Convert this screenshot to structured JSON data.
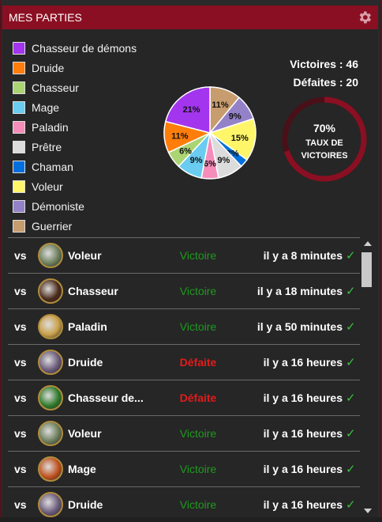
{
  "header": {
    "title": "MES PARTIES"
  },
  "legend": [
    {
      "label": "Chasseur de démons",
      "color": "#a335ee"
    },
    {
      "label": "Druide",
      "color": "#ff7d0a"
    },
    {
      "label": "Chasseur",
      "color": "#abd473"
    },
    {
      "label": "Mage",
      "color": "#69ccf0"
    },
    {
      "label": "Paladin",
      "color": "#f58cba"
    },
    {
      "label": "Prêtre",
      "color": "#dcdcdc"
    },
    {
      "label": "Chaman",
      "color": "#0070de"
    },
    {
      "label": "Voleur",
      "color": "#fff569"
    },
    {
      "label": "Démoniste",
      "color": "#9482c9"
    },
    {
      "label": "Guerrier",
      "color": "#c79c6e"
    }
  ],
  "stats": {
    "victoires": "Victoires : 46",
    "defaites": "Défaites : 20"
  },
  "winrate": {
    "percent": "70%",
    "label_line1": "TAUX DE",
    "label_line2": "VICTOIRES",
    "value": 0.7
  },
  "chart_data": {
    "type": "pie",
    "slices": [
      {
        "class": "Guerrier",
        "value": 11,
        "label": "11%",
        "color": "#c79c6e"
      },
      {
        "class": "Démoniste",
        "value": 9,
        "label": "9%",
        "color": "#9482c9"
      },
      {
        "class": "Voleur",
        "value": 15,
        "label": "15%",
        "color": "#fff569"
      },
      {
        "class": "Chaman",
        "value": 3,
        "label": "3%",
        "color": "#0070de"
      },
      {
        "class": "Prêtre",
        "value": 9,
        "label": "9%",
        "color": "#dcdcdc"
      },
      {
        "class": "Paladin",
        "value": 6,
        "label": "6%",
        "color": "#f58cba"
      },
      {
        "class": "Mage",
        "value": 9,
        "label": "9%",
        "color": "#69ccf0"
      },
      {
        "class": "Chasseur",
        "value": 6,
        "label": "6%",
        "color": "#abd473"
      },
      {
        "class": "Druide",
        "value": 11,
        "label": "11%",
        "color": "#ff7d0a"
      },
      {
        "class": "Chasseur de démons",
        "value": 21,
        "label": "21%",
        "color": "#a335ee"
      }
    ]
  },
  "matches": [
    {
      "vs": "vs",
      "opponent": "Voleur",
      "result": "Victoire",
      "win": true,
      "time": "il y a 8 minutes",
      "check": "✓",
      "avatar_color": "#6b7d5a"
    },
    {
      "vs": "vs",
      "opponent": "Chasseur",
      "result": "Victoire",
      "win": true,
      "time": "il y a 18 minutes",
      "check": "✓",
      "avatar_color": "#4a2a1a"
    },
    {
      "vs": "vs",
      "opponent": "Paladin",
      "result": "Victoire",
      "win": true,
      "time": "il y a 50 minutes",
      "check": "✓",
      "avatar_color": "#c9a04a"
    },
    {
      "vs": "vs",
      "opponent": "Druide",
      "result": "Défaite",
      "win": false,
      "time": "il y a 16 heures",
      "check": "✓",
      "avatar_color": "#6a5a7a"
    },
    {
      "vs": "vs",
      "opponent": "Chasseur de...",
      "result": "Défaite",
      "win": false,
      "time": "il y a 16 heures",
      "check": "✓",
      "avatar_color": "#2f7a2a"
    },
    {
      "vs": "vs",
      "opponent": "Voleur",
      "result": "Victoire",
      "win": true,
      "time": "il y a 16 heures",
      "check": "✓",
      "avatar_color": "#6b7d5a"
    },
    {
      "vs": "vs",
      "opponent": "Mage",
      "result": "Victoire",
      "win": true,
      "time": "il y a 16 heures",
      "check": "✓",
      "avatar_color": "#c0501e"
    },
    {
      "vs": "vs",
      "opponent": "Druide",
      "result": "Victoire",
      "win": true,
      "time": "il y a 16 heures",
      "check": "✓",
      "avatar_color": "#6a5a7a"
    }
  ]
}
